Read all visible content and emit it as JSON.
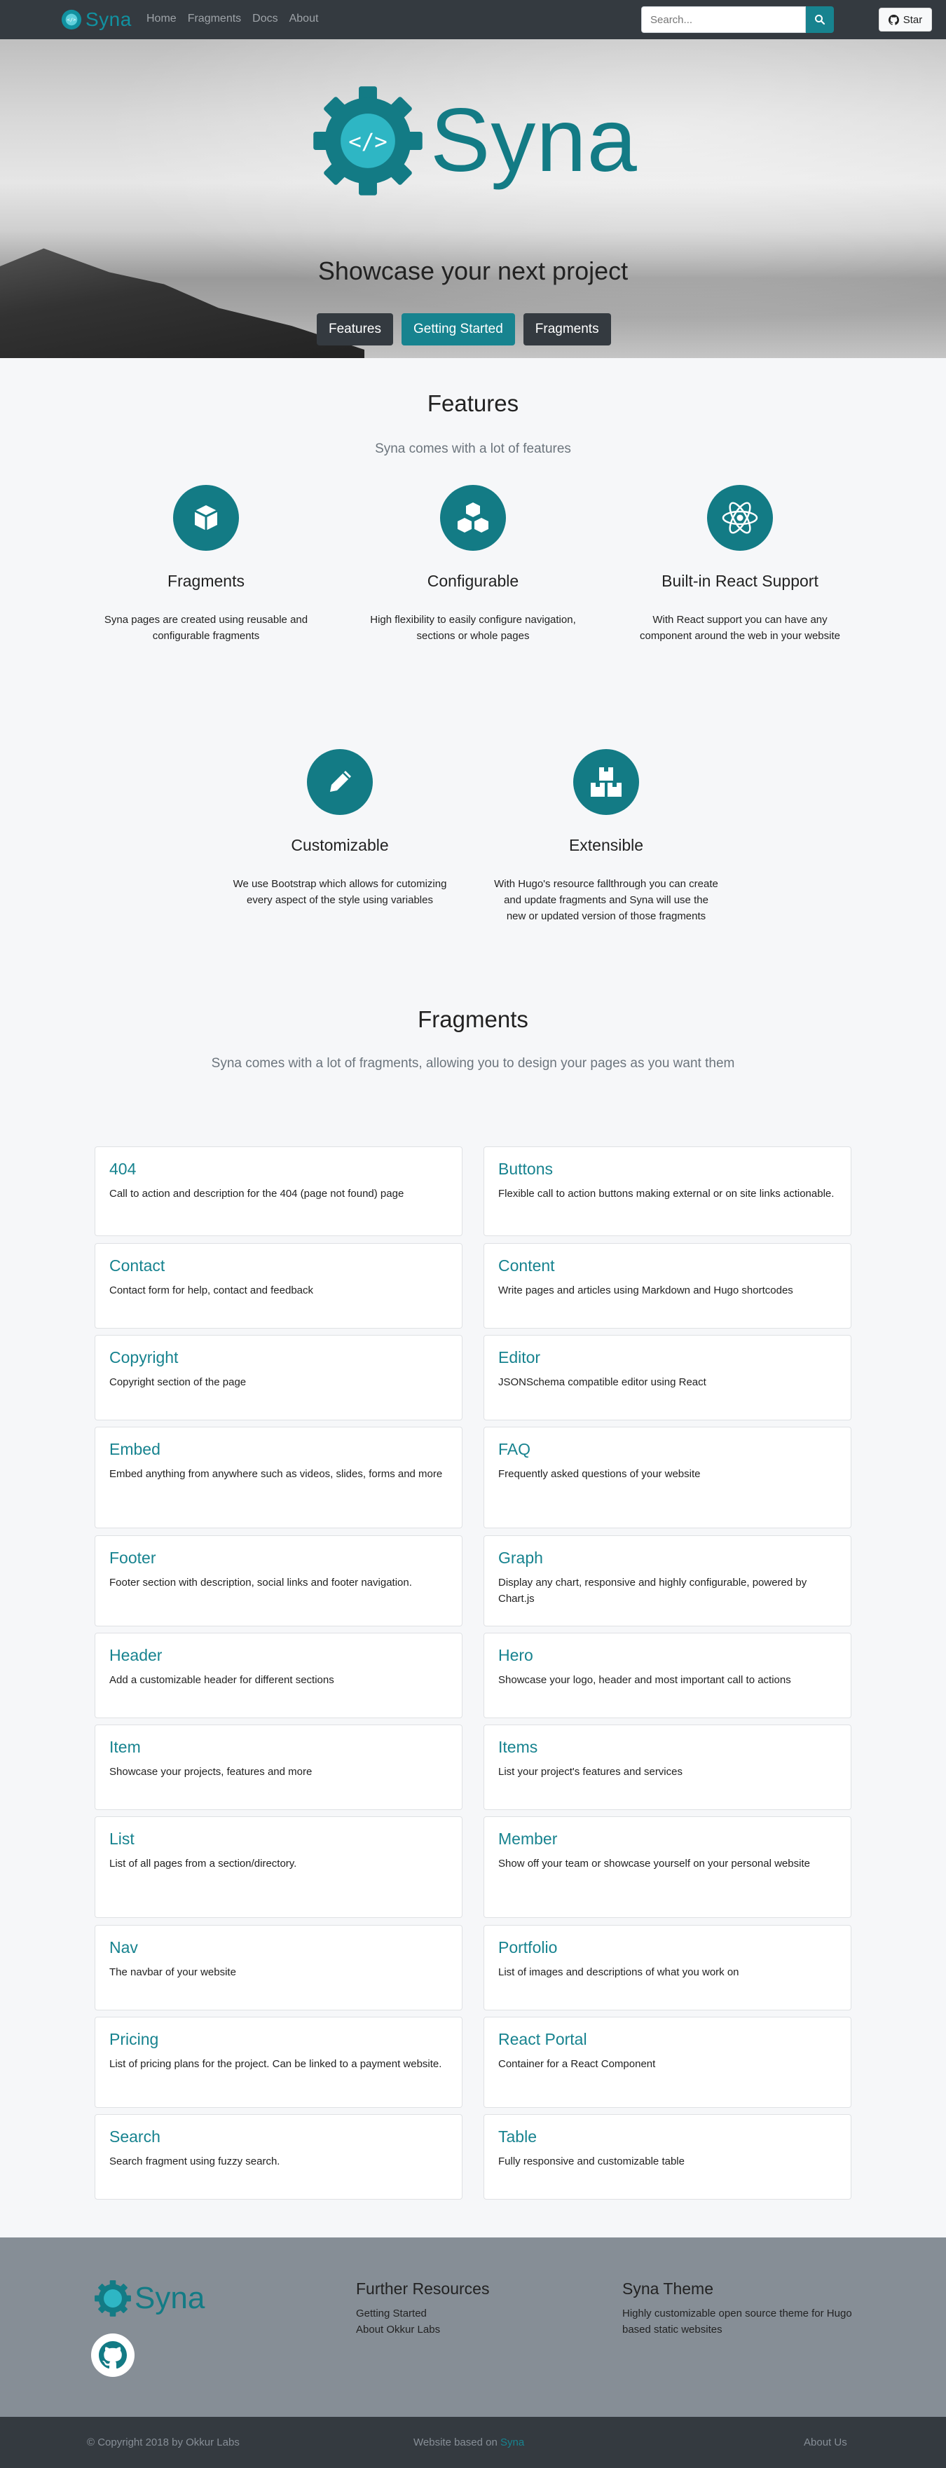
{
  "navbar": {
    "brand": "Syna",
    "links": [
      "Home",
      "Fragments",
      "Docs",
      "About"
    ],
    "search_placeholder": "Search...",
    "star_label": "Star"
  },
  "hero": {
    "logo_text": "Syna",
    "title": "Showcase your next project",
    "buttons": [
      "Features",
      "Getting Started",
      "Fragments"
    ]
  },
  "features": {
    "title": "Features",
    "subtitle": "Syna comes with a lot of features",
    "items": [
      {
        "title": "Fragments",
        "desc": "Syna pages are created using reusable and configurable fragments",
        "icon": "cube-icon"
      },
      {
        "title": "Configurable",
        "desc": "High flexibility to easily configure navigation, sections or whole pages",
        "icon": "cubes-icon"
      },
      {
        "title": "Built-in React Support",
        "desc": "With React support you can have any component around the web in your website",
        "icon": "react-icon"
      },
      {
        "title": "Customizable",
        "desc": "We use Bootstrap which allows for cutomizing every aspect of the style using variables",
        "icon": "pencil-icon"
      },
      {
        "title": "Extensible",
        "desc": "With Hugo's resource fallthrough you can create and update fragments and Syna will use the new or updated version of those fragments",
        "icon": "boxes-icon"
      }
    ]
  },
  "fragments": {
    "title": "Fragments",
    "subtitle": "Syna comes with a lot of fragments, allowing you to design your pages as you want them",
    "items": [
      {
        "title": "404",
        "desc": "Call to action and description for the 404 (page not found) page"
      },
      {
        "title": "Buttons",
        "desc": "Flexible call to action buttons making external or on site links actionable."
      },
      {
        "title": "Contact",
        "desc": "Contact form for help, contact and feedback"
      },
      {
        "title": "Content",
        "desc": "Write pages and articles using Markdown and Hugo shortcodes"
      },
      {
        "title": "Copyright",
        "desc": "Copyright section of the page"
      },
      {
        "title": "Editor",
        "desc": "JSONSchema compatible editor using React"
      },
      {
        "title": "Embed",
        "desc": "Embed anything from anywhere such as videos, slides, forms and more"
      },
      {
        "title": "FAQ",
        "desc": "Frequently asked questions of your website"
      },
      {
        "title": "Footer",
        "desc": "Footer section with description, social links and footer navigation."
      },
      {
        "title": "Graph",
        "desc": "Display any chart, responsive and highly configurable, powered by Chart.js"
      },
      {
        "title": "Header",
        "desc": "Add a customizable header for different sections"
      },
      {
        "title": "Hero",
        "desc": "Showcase your logo, header and most important call to actions"
      },
      {
        "title": "Item",
        "desc": "Showcase your projects, features and more"
      },
      {
        "title": "Items",
        "desc": "List your project's features and services"
      },
      {
        "title": "List",
        "desc": "List of all pages from a section/directory."
      },
      {
        "title": "Member",
        "desc": "Show off your team or showcase yourself on your personal website"
      },
      {
        "title": "Nav",
        "desc": "The navbar of your website"
      },
      {
        "title": "Portfolio",
        "desc": "List of images and descriptions of what you work on"
      },
      {
        "title": "Pricing",
        "desc": "List of pricing plans for the project. Can be linked to a payment website."
      },
      {
        "title": "React Portal",
        "desc": "Container for a React Component"
      },
      {
        "title": "Search",
        "desc": "Search fragment using fuzzy search."
      },
      {
        "title": "Table",
        "desc": "Fully responsive and customizable table"
      }
    ]
  },
  "footer": {
    "logo_text": "Syna",
    "resources_title": "Further Resources",
    "resources_links": [
      "Getting Started",
      "About Okkur Labs"
    ],
    "theme_title": "Syna Theme",
    "theme_desc": "Highly customizable open source theme for Hugo based static websites",
    "copyright": "© Copyright 2018 by Okkur Labs",
    "based_on_prefix": "Website based on ",
    "based_on_link": "Syna",
    "about_link": "About Us"
  },
  "colors": {
    "accent": "#17838f",
    "dark": "#343a40",
    "footer": "#868e96"
  }
}
